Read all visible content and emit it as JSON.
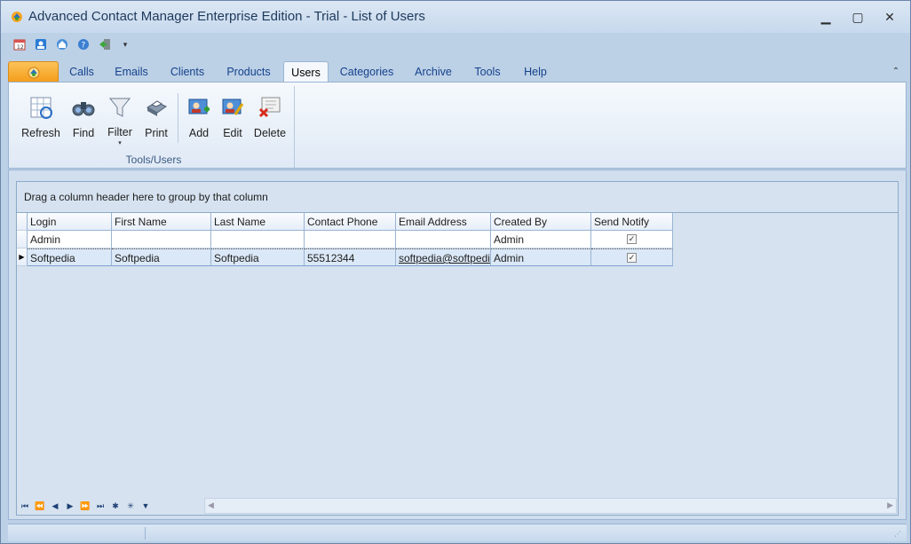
{
  "window": {
    "title": "Advanced Contact Manager Enterprise Edition - Trial - List of Users",
    "min_glyph": "▁",
    "max_glyph": "▢",
    "close_glyph": "✕"
  },
  "qat": {
    "icons": [
      "calendar-icon",
      "contacts-icon",
      "home-icon",
      "help-icon",
      "exit-icon"
    ],
    "customize_glyph": "▾"
  },
  "tabs": {
    "items": [
      "Calls",
      "Emails",
      "Clients",
      "Products",
      "Users",
      "Categories",
      "Archive",
      "Tools",
      "Help"
    ],
    "active": "Users",
    "collapse_glyph": "⌃"
  },
  "ribbon": {
    "group_label": "Tools/Users",
    "buttons": {
      "refresh": "Refresh",
      "find": "Find",
      "filter": "Filter",
      "print": "Print",
      "add": "Add",
      "edit": "Edit",
      "delete": "Delete"
    },
    "filter_dropdown_glyph": "▾"
  },
  "grid": {
    "group_hint": "Drag a column header here to group by that column",
    "columns": [
      "Login",
      "First Name",
      "Last Name",
      "Contact Phone",
      "Email Address",
      "Created By",
      "Send Notify"
    ],
    "rows": [
      {
        "login": "Admin",
        "first_name": "",
        "last_name": "",
        "phone": "",
        "email": "",
        "created_by": "Admin",
        "send_notify": true,
        "selected": false
      },
      {
        "login": "Softpedia",
        "first_name": "Softpedia",
        "last_name": "Softpedia",
        "phone": "55512344",
        "email": "softpedia@softpedia.c",
        "created_by": "Admin",
        "send_notify": true,
        "selected": true
      }
    ],
    "row_indicator_glyph": "▶",
    "check_glyph": "✓"
  },
  "navigator": {
    "buttons": [
      "⏮",
      "⏪",
      "◀",
      "▶",
      "⏩",
      "⏭",
      "✱",
      "✳",
      "▼"
    ],
    "button_names": [
      "first-record-icon",
      "prev-page-icon",
      "prev-record-icon",
      "next-record-icon",
      "next-page-icon",
      "last-record-icon",
      "append-icon",
      "delete-record-icon",
      "filter-icon"
    ]
  },
  "scroll": {
    "left_glyph": "◀",
    "right_glyph": "▶"
  },
  "colors": {
    "accent": "#15428b",
    "app_menu": "#f49b17",
    "ribbon_bg": "#dfe9f5"
  }
}
